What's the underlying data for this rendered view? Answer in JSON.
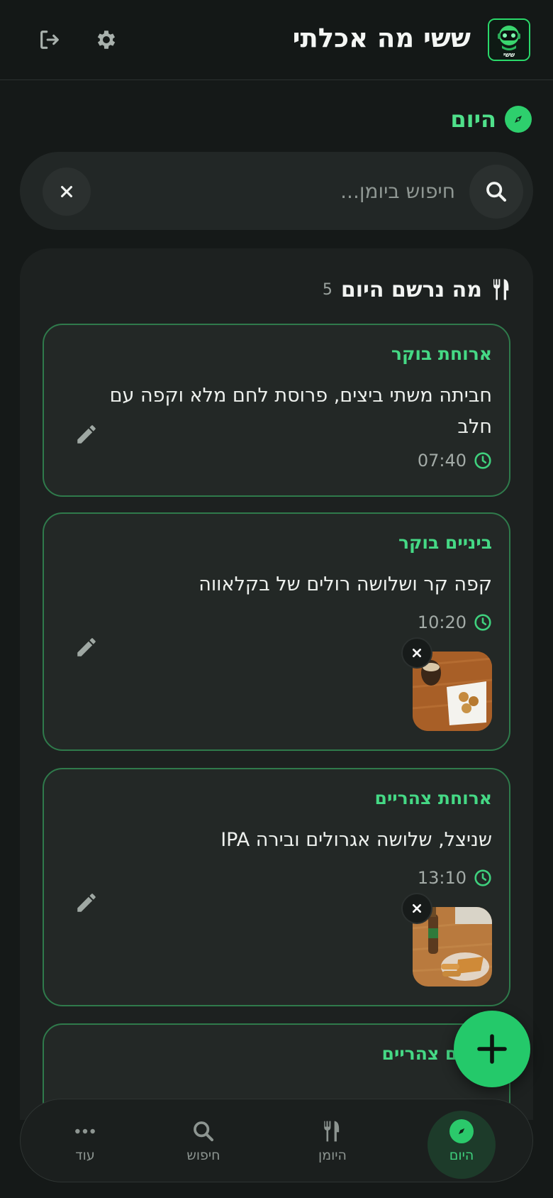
{
  "header": {
    "title": "ששי מה אכלתי",
    "logo_text": "ששי",
    "icons": [
      "settings-gear-icon",
      "logout-icon"
    ]
  },
  "section": {
    "title": "היום",
    "icon": "compass-icon"
  },
  "search": {
    "placeholder": "חיפוש ביומן...",
    "value": ""
  },
  "list": {
    "title": "מה נרשם היום",
    "count": "5",
    "icon": "utensils-icon",
    "entries": [
      {
        "meal_type": "ארוחת בוקר",
        "description": "חביתה משתי ביצים, פרוסת לחם מלא וקפה עם חלב",
        "time": "07:40",
        "has_photo": false
      },
      {
        "meal_type": "ביניים בוקר",
        "description": "קפה קר ושלושה רולים של בקלאווה",
        "time": "10:20",
        "has_photo": true
      },
      {
        "meal_type": "ארוחת צהריים",
        "description": "שניצל, שלושה אגרולים ובירה IPA",
        "time": "13:10",
        "has_photo": true
      },
      {
        "meal_type": "ביניים צהריים",
        "description": "",
        "time": "",
        "has_photo": false
      }
    ]
  },
  "bottom_nav": {
    "items": [
      {
        "label": "היום",
        "icon": "compass-icon",
        "active": true
      },
      {
        "label": "היומן",
        "icon": "utensils-icon",
        "active": false
      },
      {
        "label": "חיפוש",
        "icon": "search-icon",
        "active": false
      },
      {
        "label": "עוד",
        "icon": "more-dots-icon",
        "active": false
      }
    ]
  },
  "colors": {
    "background": "#151918",
    "accent": "#2ecf6d",
    "card_border": "#2f7a4b",
    "meal_type_text": "#45d985"
  }
}
